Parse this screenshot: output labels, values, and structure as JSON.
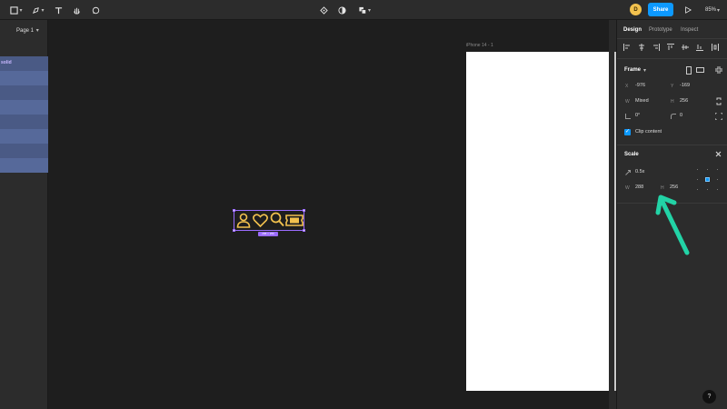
{
  "toolbar": {
    "zoom": "85%",
    "share_label": "Share",
    "user_initial": "D"
  },
  "left_panel": {
    "page_label": "Page 1",
    "layer_text": "solid"
  },
  "canvas": {
    "frame_label": "iPhone 14 - 1",
    "selection_badge": "288 × 256"
  },
  "right_panel": {
    "tabs": [
      "Design",
      "Prototype",
      "Inspect"
    ],
    "frame_title": "Frame",
    "x_label": "X",
    "x_value": "-976",
    "y_label": "Y",
    "y_value": "-169",
    "w_label": "W",
    "w_value": "Mixed",
    "h_label": "H",
    "h_value": "256",
    "rotation_value": "0°",
    "radius_value": "0",
    "clip_label": "Clip content",
    "scale_title": "Scale",
    "scale_value": "0.5x",
    "scale_w_label": "W",
    "scale_w_value": "288",
    "scale_h_label": "H",
    "scale_h_value": "256"
  },
  "help_label": "?",
  "colors": {
    "accent": "#0d99ff",
    "selection": "#9b6cff",
    "icon": "#f2c14e",
    "arrow": "#22d3a6"
  },
  "icons": [
    "frame-tool-icon",
    "pen-tool-icon",
    "text-tool-icon",
    "hand-tool-icon",
    "comment-tool-icon",
    "components-icon",
    "contrast-icon",
    "multiplayer-icon",
    "play-icon",
    "user-icon",
    "heart-icon",
    "search-icon",
    "ticket-icon"
  ]
}
